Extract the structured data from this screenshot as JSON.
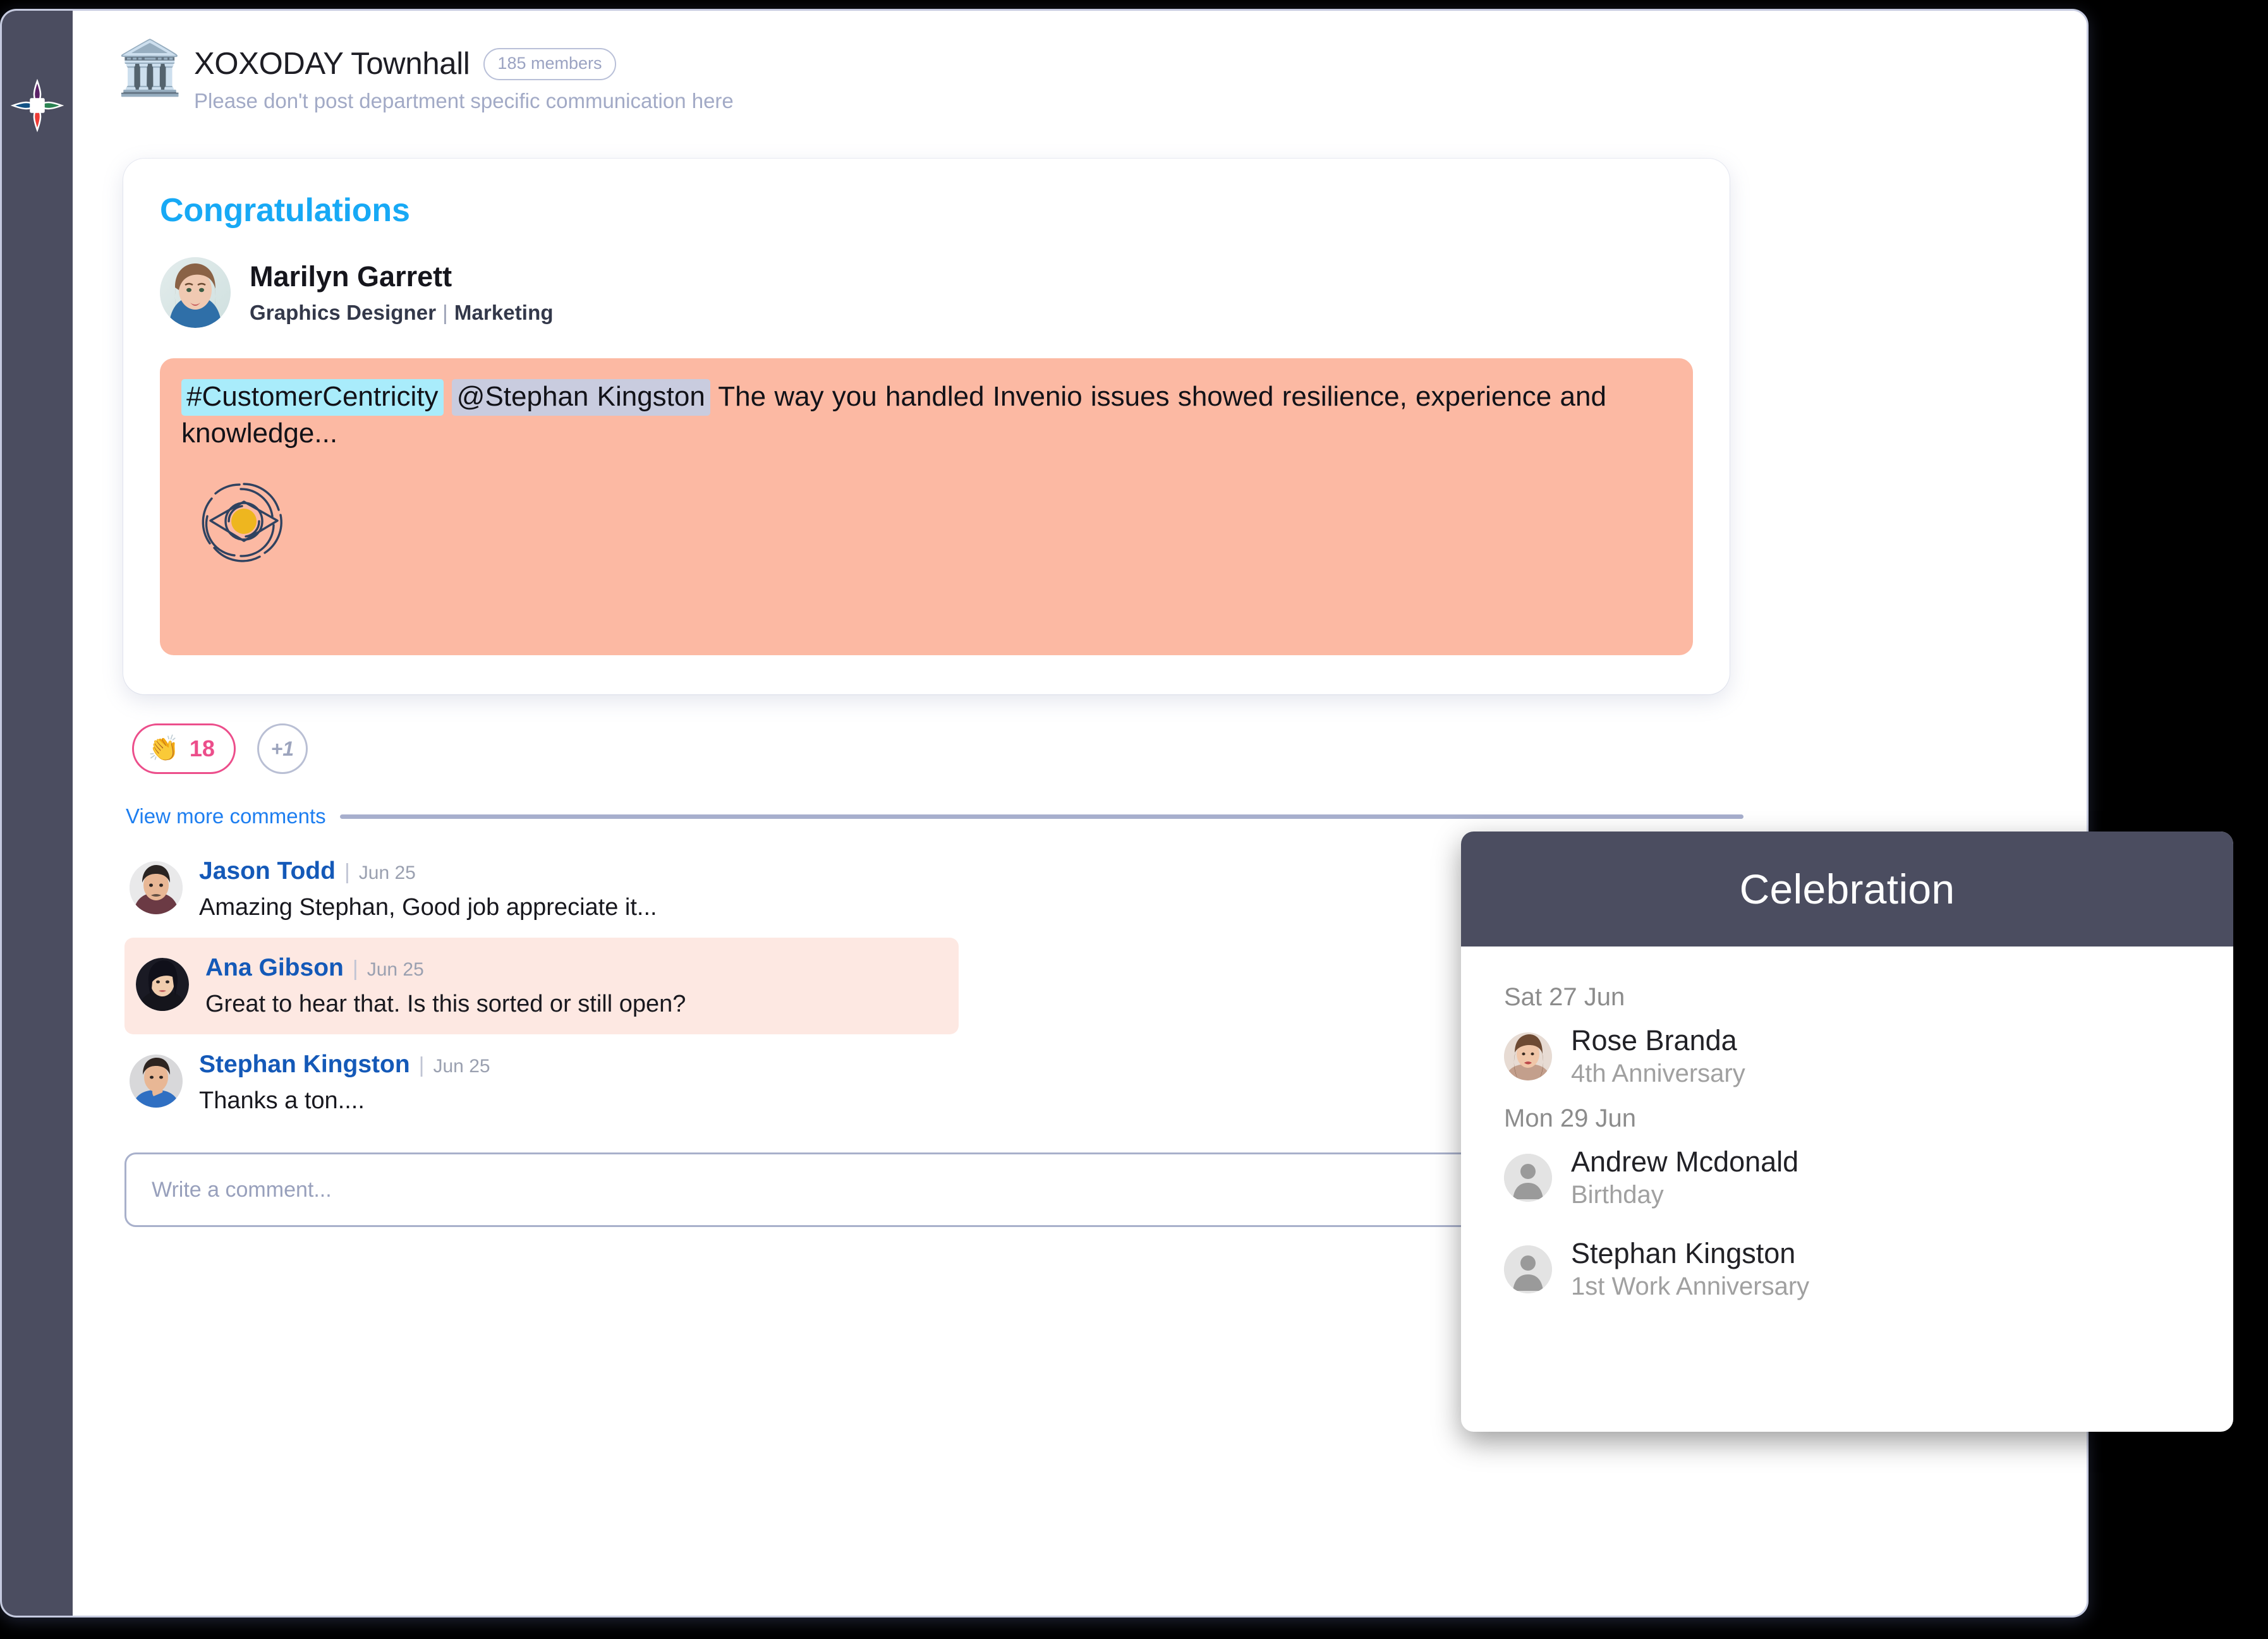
{
  "window": {
    "rail_logo_icon": "four-point-star-logo"
  },
  "channel": {
    "icon": "classical-building-emoji",
    "emoji": "🏛️",
    "title": "XOXODAY Townhall",
    "members_badge": "185 members",
    "subtitle": "Please don't post department specific communication here"
  },
  "post": {
    "heading": "Congratulations",
    "author": {
      "name": "Marilyn Garrett",
      "role": "Graphics Designer",
      "separator": "|",
      "department": "Marketing"
    },
    "message": {
      "hashtag": "#CustomerCentricity",
      "mention": "@Stephan Kingston",
      "body": "The way you handled Invenio issues showed resilience, experience and knowledge...",
      "badge_icon": "eye-award-icon",
      "background_color": "#fcb9a3",
      "hashtag_highlight_color": "#a9ecfb",
      "mention_highlight_color": "#c9ccdf"
    },
    "reactions": {
      "clap_icon": "clapping-hands-icon",
      "clap_emoji": "👏",
      "clap_count": "18",
      "add_reaction_label": "+1",
      "accent_color": "#ec4e8b"
    },
    "view_more_label": "View more comments",
    "view_more_color": "#1d7ef0"
  },
  "comments": [
    {
      "name": "Jason Todd",
      "separator": "|",
      "date": "Jun 25",
      "text": "Amazing Stephan, Good job appreciate it...",
      "highlighted": false
    },
    {
      "name": "Ana Gibson",
      "separator": "|",
      "date": "Jun 25",
      "text": "Great to hear that. Is this sorted or still open?",
      "highlighted": true
    },
    {
      "name": "Stephan Kingston",
      "separator": "|",
      "date": "Jun 25",
      "text": "Thanks a ton....",
      "highlighted": false
    }
  ],
  "comment_input": {
    "placeholder": "Write a comment...",
    "value": ""
  },
  "celebration": {
    "title": "Celebration",
    "header_color": "#4b4d60",
    "groups": [
      {
        "date": "Sat 27 Jun",
        "people": [
          {
            "name": "Rose Branda",
            "occasion": "4th Anniversary",
            "avatar": "photo"
          }
        ]
      },
      {
        "date": "Mon 29 Jun",
        "people": [
          {
            "name": "Andrew Mcdonald",
            "occasion": "Birthday",
            "avatar": "default-user-icon"
          },
          {
            "name": "Stephan Kingston",
            "occasion": "1st Work Anniversary",
            "avatar": "default-user-icon"
          }
        ]
      }
    ]
  }
}
